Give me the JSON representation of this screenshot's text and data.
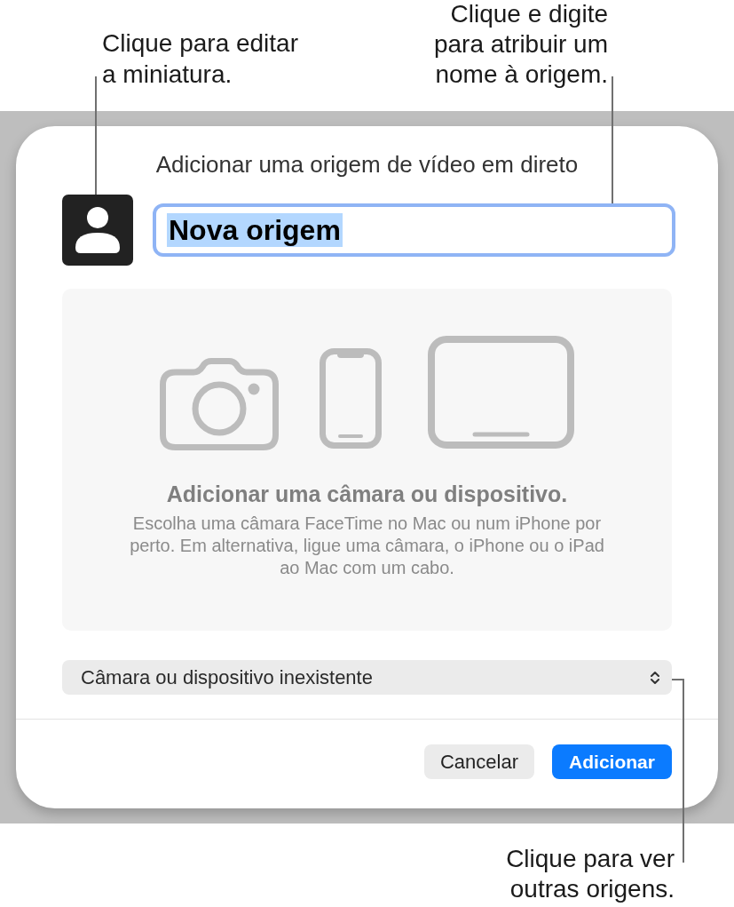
{
  "callouts": {
    "thumbnail": "Clique para editar\na miniatura.",
    "name_field": "Clique e digite\npara atribuir um\nnome à origem.",
    "source_menu": "Clique para ver\noutras origens."
  },
  "dialog": {
    "title": "Adicionar uma origem de vídeo em direto",
    "name_field": {
      "value": "Nova origem",
      "focused": true,
      "text_selected": true
    },
    "empty_state": {
      "heading": "Adicionar uma câmara ou dispositivo.",
      "body": "Escolha uma câmara FaceTime no Mac ou num iPhone por\nperto. Em alternativa, ligue uma câmara, o iPhone ou o iPad\nao Mac com um cabo."
    },
    "source_menu": {
      "value": "Câmara ou dispositivo inexistente"
    },
    "buttons": [
      {
        "label": "Cancelar",
        "kind": "secondary"
      },
      {
        "label": "Adicionar",
        "kind": "primary"
      }
    ]
  }
}
